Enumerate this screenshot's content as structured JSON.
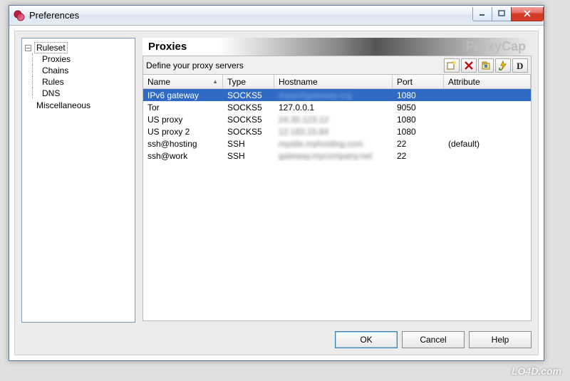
{
  "window": {
    "title": "Preferences"
  },
  "tree": {
    "root": "Ruleset",
    "items": [
      "Proxies",
      "Chains",
      "Rules",
      "DNS"
    ],
    "extra": "Miscellaneous"
  },
  "section": {
    "title": "Proxies",
    "brand": "ProxyCap",
    "description": "Define your proxy servers"
  },
  "columns": {
    "name": "Name",
    "type": "Type",
    "host": "Hostname",
    "port": "Port",
    "attr": "Attribute"
  },
  "proxies": [
    {
      "name": "IPv6 gateway",
      "type": "SOCKS5",
      "host": "myipv6gateway.org",
      "port": "1080",
      "attr": "",
      "blurred": true,
      "selected": true
    },
    {
      "name": "Tor",
      "type": "SOCKS5",
      "host": "127.0.0.1",
      "port": "9050",
      "attr": "",
      "blurred": false
    },
    {
      "name": "US proxy",
      "type": "SOCKS5",
      "host": "24.30.123.12",
      "port": "1080",
      "attr": "",
      "blurred": true
    },
    {
      "name": "US proxy 2",
      "type": "SOCKS5",
      "host": "12.183.15.84",
      "port": "1080",
      "attr": "",
      "blurred": true
    },
    {
      "name": "ssh@hosting",
      "type": "SSH",
      "host": "mysite.myhosting.com",
      "port": "22",
      "attr": "(default)",
      "blurred": true
    },
    {
      "name": "ssh@work",
      "type": "SSH",
      "host": "gateway.mycompany.net",
      "port": "22",
      "attr": "",
      "blurred": true
    }
  ],
  "toolbar_icons": [
    "new-proxy-icon",
    "delete-icon",
    "properties-icon",
    "quick-add-icon",
    "display-icon"
  ],
  "buttons": {
    "ok": "OK",
    "cancel": "Cancel",
    "help": "Help"
  },
  "watermark": "LO4D.com"
}
